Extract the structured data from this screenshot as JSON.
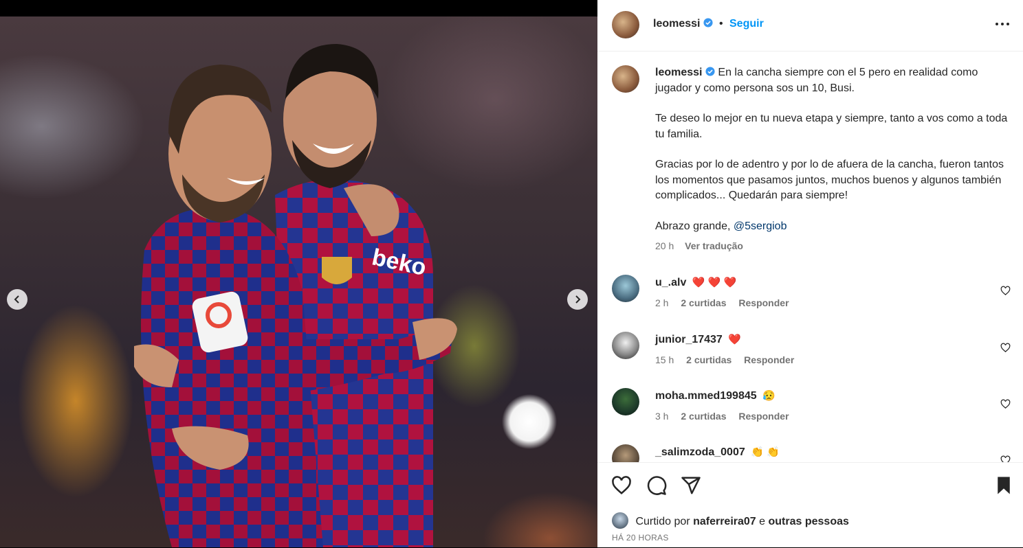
{
  "post": {
    "username": "leomessi",
    "follow_label": "Seguir",
    "separator": "•"
  },
  "caption": {
    "username": "leomessi",
    "paragraphs": [
      "En la cancha siempre con el 5 pero en realidad como jugador y como persona sos un 10, Busi.",
      "Te deseo lo mejor en tu nueva etapa y siempre, tanto a vos como a toda tu familia.",
      "Gracias por lo de adentro y por lo de afuera de la cancha, fueron tantos los momentos que pasamos juntos, muchos buenos y algunos también complicados... Quedarán para siempre!"
    ],
    "closing_text": "Abrazo grande,",
    "mention": "@5sergiob",
    "time": "20 h",
    "see_translation": "Ver tradução"
  },
  "comments": [
    {
      "username": "u_.alv",
      "text": "❤️ ❤️ ❤️",
      "time": "2 h",
      "likes": "2 curtidas",
      "reply": "Responder"
    },
    {
      "username": "junior_17437",
      "text": "❤️",
      "time": "15 h",
      "likes": "2 curtidas",
      "reply": "Responder"
    },
    {
      "username": "moha.mmed199845",
      "text": "😥",
      "time": "3 h",
      "likes": "2 curtidas",
      "reply": "Responder"
    },
    {
      "username": "_salimzoda_0007",
      "text": "👏 👏",
      "time": "",
      "likes": "",
      "reply": ""
    }
  ],
  "likes": {
    "prefix": "Curtido por",
    "user": "naferreira07",
    "connector": "e",
    "others": "outras pessoas"
  },
  "timestamp": "HÁ 20 HORAS",
  "colors": {
    "accent": "#0095f6",
    "text": "#262626",
    "secondary": "#737373",
    "verified": "#3897f0",
    "mention": "#00376b"
  }
}
